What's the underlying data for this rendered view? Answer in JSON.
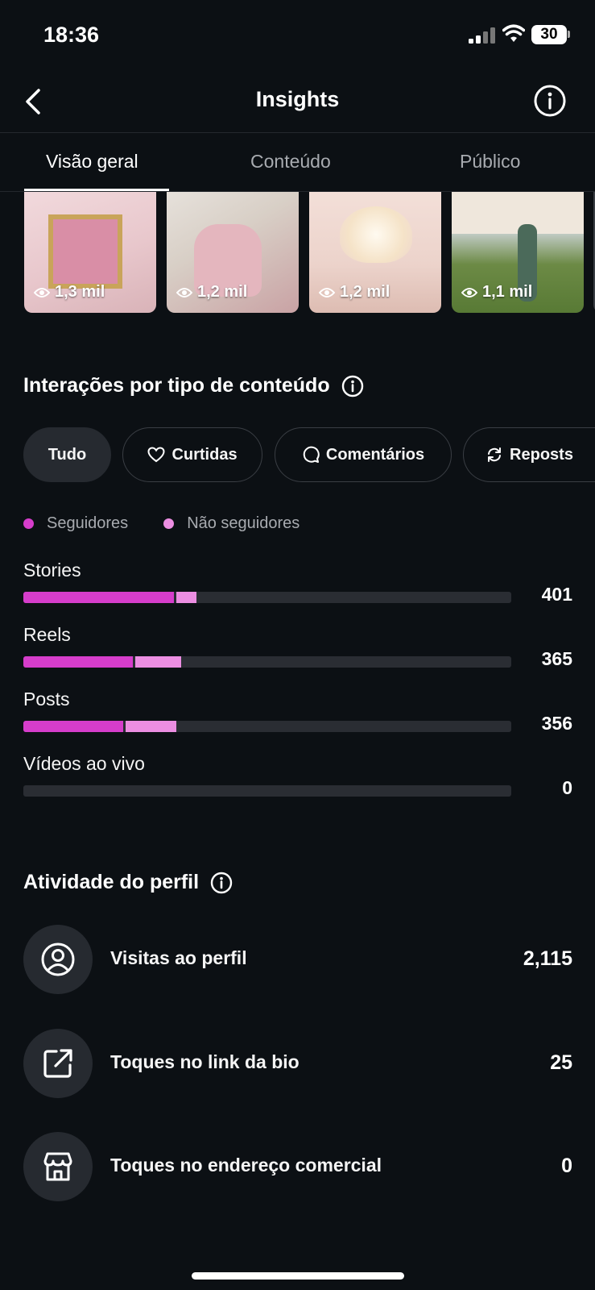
{
  "status": {
    "time": "18:36",
    "battery": "30"
  },
  "header": {
    "title": "Insights"
  },
  "tabs": [
    {
      "label": "Visão geral",
      "active": true
    },
    {
      "label": "Conteúdo",
      "active": false
    },
    {
      "label": "Público",
      "active": false
    }
  ],
  "top_content": [
    {
      "views": "1,3 mil"
    },
    {
      "views": "1,2 mil"
    },
    {
      "views": "1,2 mil"
    },
    {
      "views": "1,1 mil"
    }
  ],
  "interactions": {
    "title": "Interações por tipo de conteúdo",
    "filters": [
      {
        "label": "Tudo",
        "icon": "none",
        "active": true
      },
      {
        "label": "Curtidas",
        "icon": "heart-icon",
        "active": false
      },
      {
        "label": "Comentários",
        "icon": "comment-icon",
        "active": false
      },
      {
        "label": "Reposts",
        "icon": "repost-icon",
        "active": false
      }
    ],
    "legend": {
      "followers": "Seguidores",
      "non_followers": "Não seguidores"
    },
    "colors": {
      "followers": "#d63dcb",
      "non_followers": "#ec8ee2",
      "track": "#2a2d33"
    },
    "rows": [
      {
        "label": "Stories",
        "value": "401"
      },
      {
        "label": "Reels",
        "value": "365"
      },
      {
        "label": "Posts",
        "value": "356"
      },
      {
        "label": "Vídeos ao vivo",
        "value": "0"
      }
    ]
  },
  "chart_data": {
    "type": "bar",
    "orientation": "horizontal",
    "stacked": true,
    "categories": [
      "Stories",
      "Reels",
      "Posts",
      "Vídeos ao vivo"
    ],
    "series": [
      {
        "name": "Seguidores",
        "values": [
          348,
          253,
          232,
          0
        ]
      },
      {
        "name": "Não seguidores",
        "values": [
          53,
          112,
          124,
          0
        ]
      }
    ],
    "totals": [
      401,
      365,
      356,
      0
    ],
    "xlim": [
      0,
      1130
    ]
  },
  "profile_activity": {
    "title": "Atividade do perfil",
    "items": [
      {
        "label": "Visitas ao perfil",
        "value": "2,115",
        "icon": "profile-icon"
      },
      {
        "label": "Toques no link da bio",
        "value": "25",
        "icon": "external-link-icon"
      },
      {
        "label": "Toques no endereço comercial",
        "value": "0",
        "icon": "storefront-icon"
      }
    ]
  }
}
